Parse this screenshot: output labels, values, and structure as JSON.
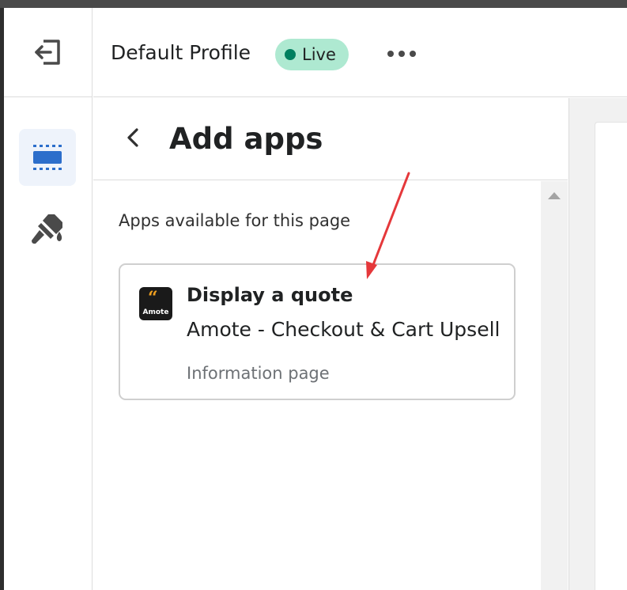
{
  "header": {
    "exit_icon": "exit-editor-icon",
    "profile_name": "Default Profile",
    "status_badge": "Live",
    "status_color": "#007f5f",
    "badge_background": "#aee9d1",
    "more_icon": "more-horizontal-icon"
  },
  "sidebar": {
    "items": [
      {
        "icon": "sections-icon",
        "active": true,
        "accent": "#2c6ecb"
      },
      {
        "icon": "theme-settings-brush-icon",
        "active": false
      }
    ]
  },
  "panel": {
    "back_icon": "chevron-left-icon",
    "title": "Add apps",
    "section_label": "Apps available for this page",
    "apps": [
      {
        "icon": "amote-app-icon",
        "icon_label": "Amote",
        "icon_glyph": "“",
        "title": "Display a quote",
        "app_name": "Amote - Checkout & Cart Upsell",
        "page_type": "Information page"
      }
    ]
  },
  "annotation": {
    "arrow_color": "#e5383b"
  }
}
